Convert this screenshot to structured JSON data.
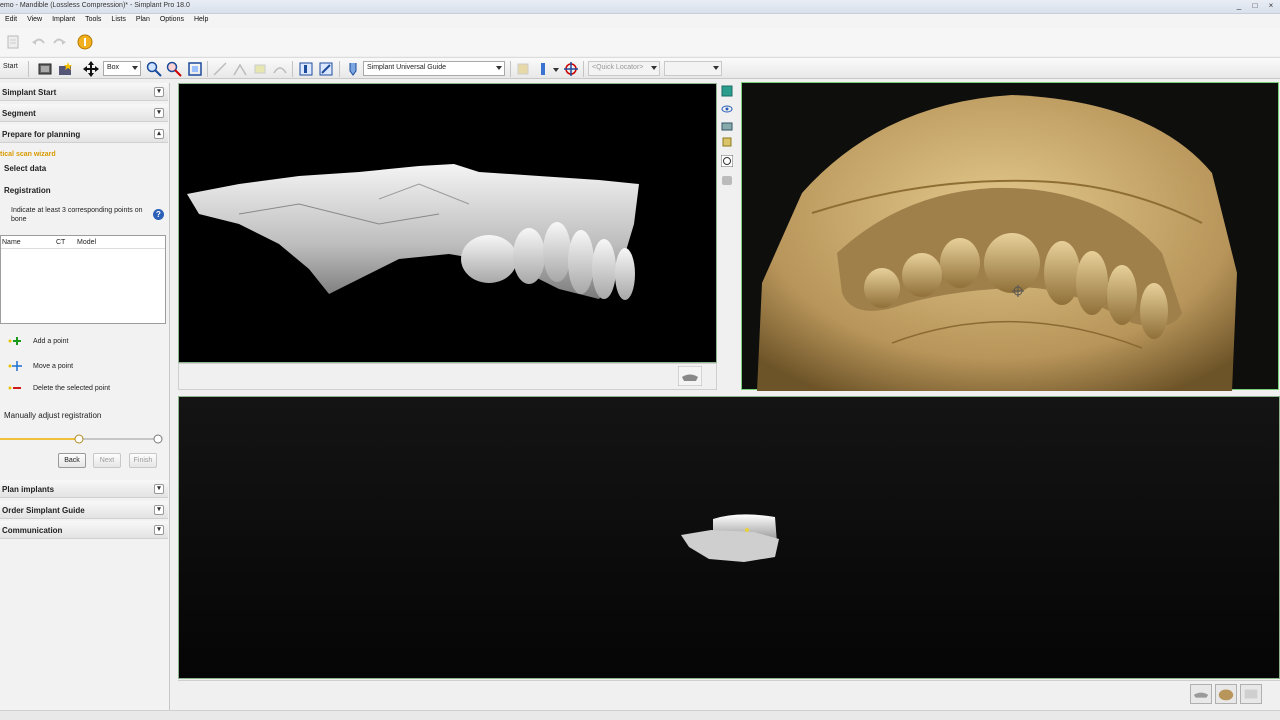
{
  "window": {
    "title": "emo - Mandible (Lossless Compression)* - Simplant Pro 18.0",
    "controls": [
      "_",
      "□",
      "×"
    ]
  },
  "menu": [
    "Edit",
    "View",
    "Implant",
    "Tools",
    "Lists",
    "Plan",
    "Options",
    "Help"
  ],
  "toolbar": {
    "start_label": "Start",
    "box_combo": "Box",
    "guide_combo": "Simplant Universal Guide",
    "locator_combo": "<Quick Locator>",
    "empty_combo": ""
  },
  "sidebar": {
    "sections_top": [
      {
        "label": "Simplant Start"
      },
      {
        "label": "Segment"
      },
      {
        "label": "Prepare for planning"
      }
    ],
    "wizard_title": "tical scan wizard",
    "step_select": "Select data",
    "step_registration": "Registration",
    "instruction": "Indicate at least 3 corresponding points on bone",
    "table_headers": {
      "name": "Name",
      "ct": "CT",
      "model": "Model"
    },
    "actions": {
      "add": "Add a point",
      "move": "Move a point",
      "delete": "Delete the selected point"
    },
    "manual_adjust": "Manually adjust registration",
    "slider_value": 0.5,
    "buttons": {
      "back": "Back",
      "next": "Next",
      "finish": "Finish"
    },
    "sections_bottom": [
      {
        "label": "Plan implants"
      },
      {
        "label": "Order Simplant Guide"
      },
      {
        "label": "Communication"
      }
    ]
  },
  "colors": {
    "wizard_accent": "#d99a00",
    "model_gold": "#c9a96e",
    "viewport_active_border": "#79d179",
    "help_blue": "#2b5fb8"
  }
}
